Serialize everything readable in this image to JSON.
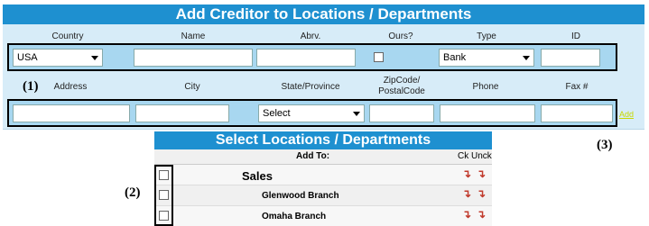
{
  "top_section": {
    "title": "Add Creditor to Locations / Departments",
    "row1_headers": {
      "country": "Country",
      "name": "Name",
      "abrv": "Abrv.",
      "ours": "Ours?",
      "type": "Type",
      "id": "ID"
    },
    "country_value": "USA",
    "type_value": "Bank",
    "row2_headers": {
      "address": "Address",
      "city": "City",
      "state": "State/Province",
      "zip_line1": "ZipCode/",
      "zip_line2": "PostalCode",
      "phone": "Phone",
      "fax": "Fax #"
    },
    "state_value": "Select",
    "add_link": "Add"
  },
  "callouts": {
    "one": "(1)",
    "two": "(2)",
    "three": "(3)"
  },
  "locations": {
    "title": "Select Locations / Departments",
    "col_add_to": "Add To:",
    "col_ck_unck": "Ck Unck",
    "rows": [
      {
        "label": "Sales",
        "level": "parent"
      },
      {
        "label": "Glenwood Branch",
        "level": "child"
      },
      {
        "label": "Omaha Branch",
        "level": "child"
      }
    ]
  },
  "colors": {
    "accent": "#1e90d0",
    "panel": "#d7ecf8",
    "cell": "#a8d7f0",
    "arrow": "#c0392b"
  }
}
